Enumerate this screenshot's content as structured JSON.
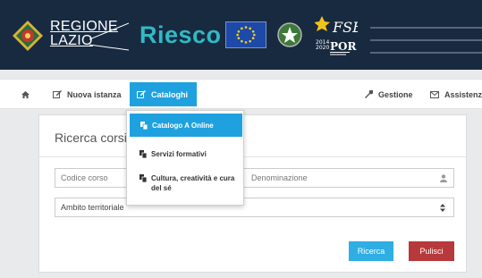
{
  "header": {
    "brand_line1": "REGIONE",
    "brand_line2": "LAZIO",
    "product_name": "Riesco",
    "por_text": "POR",
    "por_years_top": "2014",
    "por_years_bottom": "2020",
    "fse_text": "FSE",
    "colors": {
      "background": "#182a40",
      "product": "#31b9c4"
    }
  },
  "navbar": {
    "home_icon": "home-icon",
    "items": {
      "nuova_istanza": "Nuova istanza",
      "cataloghi": "Cataloghi",
      "gestione": "Gestione",
      "assistenza": "Assistenza"
    },
    "colors": {
      "active": "#1fa1df"
    }
  },
  "dropdown": {
    "items": [
      "Catalogo A Online",
      "Servizi formativi",
      "Cultura, creatività e cura del sé"
    ]
  },
  "search": {
    "title": "Ricerca corsi di",
    "codice_placeholder": "Codice corso",
    "denominazione_placeholder": "Denominazione",
    "ambito_label": "Ambito territoriale",
    "ricerca_button": "Ricerca",
    "pulisci_button": "Pulisci",
    "colors": {
      "ricerca": "#2eaee3",
      "pulisci": "#b7393b"
    }
  }
}
